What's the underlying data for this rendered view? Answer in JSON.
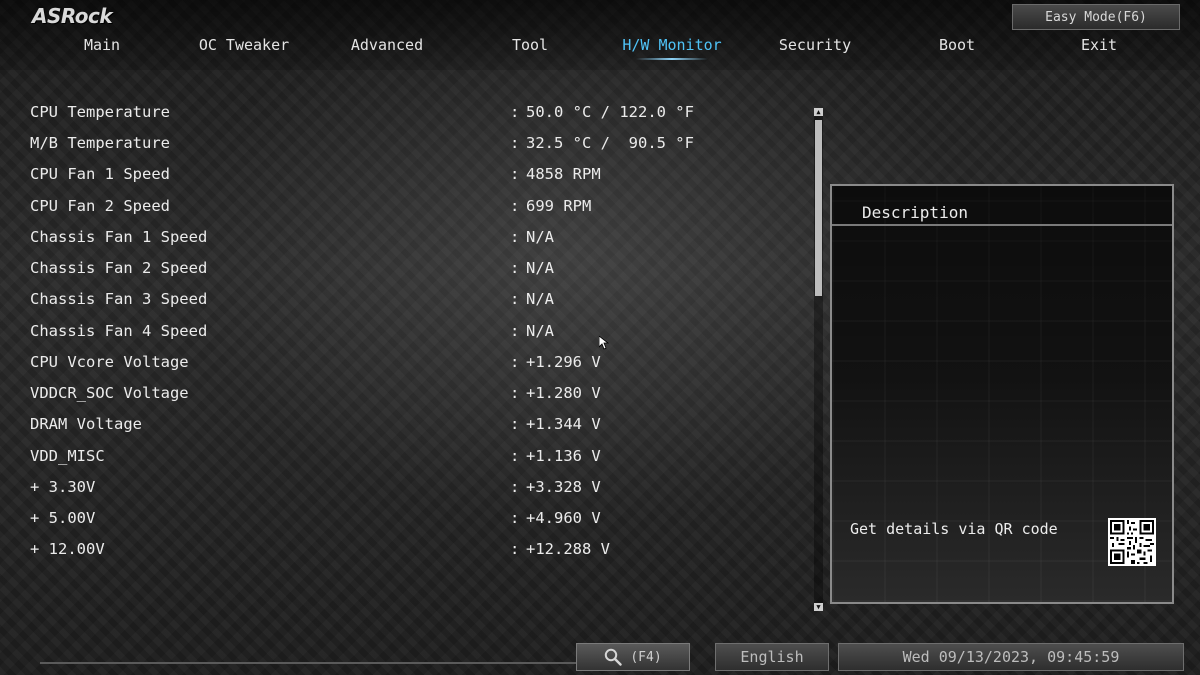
{
  "brand": "ASRock",
  "easy_mode_button": "Easy Mode(F6)",
  "nav": {
    "tabs": [
      {
        "label": "Main"
      },
      {
        "label": "OC Tweaker"
      },
      {
        "label": "Advanced"
      },
      {
        "label": "Tool"
      },
      {
        "label": "H/W Monitor",
        "active": true
      },
      {
        "label": "Security"
      },
      {
        "label": "Boot"
      },
      {
        "label": "Exit"
      }
    ]
  },
  "monitor": {
    "colon": ":",
    "rows": [
      {
        "label": "CPU Temperature",
        "value": "50.0 °C / 122.0 °F"
      },
      {
        "label": "M/B Temperature",
        "value": "32.5 °C /  90.5 °F"
      },
      {
        "label": "CPU Fan 1 Speed",
        "value": "4858 RPM"
      },
      {
        "label": "CPU Fan 2 Speed",
        "value": "699 RPM"
      },
      {
        "label": "Chassis Fan 1 Speed",
        "value": "N/A"
      },
      {
        "label": "Chassis Fan 2 Speed",
        "value": "N/A"
      },
      {
        "label": "Chassis Fan 3 Speed",
        "value": "N/A"
      },
      {
        "label": "Chassis Fan 4 Speed",
        "value": "N/A"
      },
      {
        "label": "CPU Vcore Voltage",
        "value": "+1.296 V"
      },
      {
        "label": "VDDCR_SOC Voltage",
        "value": "+1.280 V"
      },
      {
        "label": "DRAM Voltage",
        "value": "+1.344 V"
      },
      {
        "label": "VDD_MISC",
        "value": "+1.136 V"
      },
      {
        "label": "+ 3.30V",
        "value": "+3.328 V"
      },
      {
        "label": "+ 5.00V",
        "value": "+4.960 V"
      },
      {
        "label": "+ 12.00V",
        "value": "+12.288 V"
      }
    ]
  },
  "description": {
    "title": "Description",
    "qr_text": "Get details via QR code"
  },
  "footer": {
    "search_key": "(F4)",
    "language": "English",
    "datetime": "Wed 09/13/2023, 09:45:59"
  },
  "colors": {
    "accent": "#4fc3f7",
    "text": "#ececec",
    "background": "#1a1a1a"
  }
}
